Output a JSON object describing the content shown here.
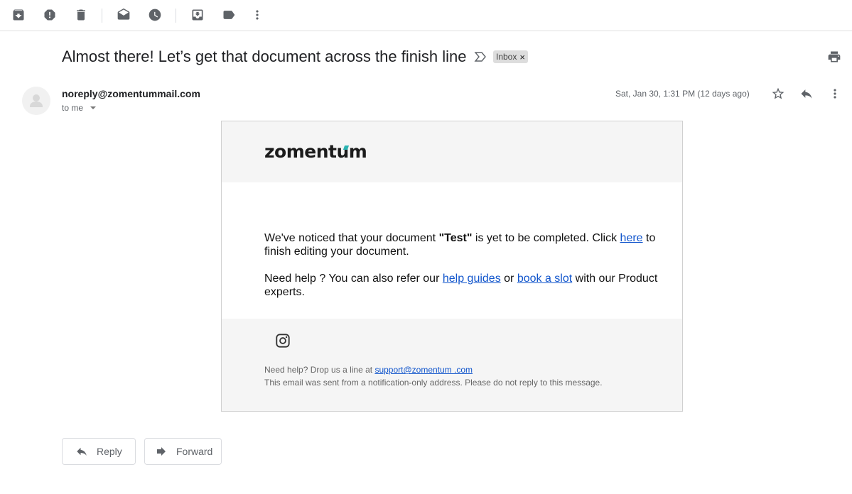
{
  "toolbar": {
    "icons": [
      "archive-icon",
      "report-spam-icon",
      "delete-icon",
      "mark-unread-icon",
      "snooze-icon",
      "move-to-inbox-icon",
      "label-icon",
      "more-vert-icon"
    ]
  },
  "email": {
    "subject": "Almost there! Let’s get that document across the finish line",
    "label": "Inbox",
    "label_close": "×",
    "sender": "noreply@zomentummail.com",
    "to": "to me",
    "date": "Sat, Jan 30, 1:31 PM (12 days ago)"
  },
  "body": {
    "logo": "zomentum",
    "line1_pre": "We've noticed that your document ",
    "doc_name": "\"Test\"",
    "line1_mid": " is yet to be completed. Click ",
    "link_here": "here",
    "line1_post": " to finish editing your document.",
    "line2_pre": "Need help ? You can also refer our ",
    "link_guides": "help guides",
    "line2_or": " or ",
    "link_slot": "book a slot",
    "line2_post": " with our Product experts.",
    "footer_help_pre": "Need help? Drop us a line at ",
    "footer_email": "support@zomentum .com",
    "footer_notice": "This email was sent from a notification-only address. Please do not reply to this message."
  },
  "actions": {
    "reply": "Reply",
    "forward": "Forward"
  },
  "colors": {
    "accent_link": "#1155cc",
    "logo_accent": "#2bb3b1",
    "card_bg": "#f5f5f5"
  }
}
